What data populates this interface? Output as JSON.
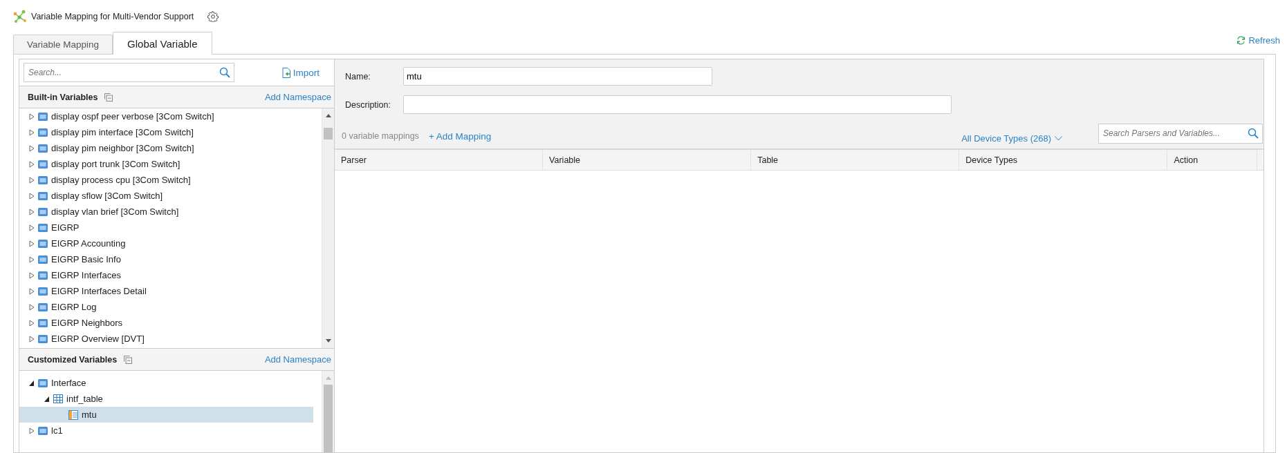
{
  "header": {
    "title": "Variable Mapping for Multi-Vendor Support"
  },
  "tabs": [
    {
      "label": "Variable Mapping",
      "selected": false
    },
    {
      "label": "Global Variable",
      "selected": true
    }
  ],
  "refresh": {
    "label": "Refresh"
  },
  "sidebar": {
    "search": {
      "placeholder": "Search..."
    },
    "import": {
      "label": "Import"
    },
    "builtin": {
      "title": "Built-in Variables",
      "action": "Add Namespace",
      "items": [
        {
          "label": "display ospf peer verbose [3Com Switch]",
          "kind": "namespace",
          "expanded": false,
          "selected": false
        },
        {
          "label": "display pim interface [3Com Switch]",
          "kind": "namespace",
          "expanded": false,
          "selected": false
        },
        {
          "label": "display pim neighbor [3Com Switch]",
          "kind": "namespace",
          "expanded": false,
          "selected": false
        },
        {
          "label": "display port trunk [3Com Switch]",
          "kind": "namespace",
          "expanded": false,
          "selected": false
        },
        {
          "label": "display process cpu [3Com Switch]",
          "kind": "namespace",
          "expanded": false,
          "selected": false
        },
        {
          "label": "display sflow [3Com Switch]",
          "kind": "namespace",
          "expanded": false,
          "selected": false
        },
        {
          "label": "display vlan brief [3Com Switch]",
          "kind": "namespace",
          "expanded": false,
          "selected": false
        },
        {
          "label": "EIGRP",
          "kind": "namespace",
          "expanded": false,
          "selected": false
        },
        {
          "label": "EIGRP Accounting",
          "kind": "namespace",
          "expanded": false,
          "selected": false
        },
        {
          "label": "EIGRP Basic Info",
          "kind": "namespace",
          "expanded": false,
          "selected": false
        },
        {
          "label": "EIGRP Interfaces",
          "kind": "namespace",
          "expanded": false,
          "selected": false
        },
        {
          "label": "EIGRP Interfaces Detail",
          "kind": "namespace",
          "expanded": false,
          "selected": false
        },
        {
          "label": "EIGRP Log",
          "kind": "namespace",
          "expanded": false,
          "selected": false
        },
        {
          "label": "EIGRP Neighbors",
          "kind": "namespace",
          "expanded": false,
          "selected": false
        },
        {
          "label": "EIGRP Overview [DVT]",
          "kind": "namespace",
          "expanded": false,
          "selected": false
        }
      ]
    },
    "customized": {
      "title": "Customized Variables",
      "action": "Add Namespace",
      "items": [
        {
          "label": "Interface",
          "kind": "namespace",
          "expanded": true,
          "selected": false,
          "children": [
            {
              "label": "intf_table",
              "kind": "table",
              "expanded": true,
              "selected": false,
              "children": [
                {
                  "label": "mtu",
                  "kind": "column",
                  "selected": true
                }
              ]
            }
          ]
        },
        {
          "label": "lc1",
          "kind": "namespace",
          "expanded": false,
          "selected": false
        }
      ]
    }
  },
  "form": {
    "name": {
      "label": "Name:",
      "value": "mtu"
    },
    "description": {
      "label": "Description:"
    }
  },
  "mappings": {
    "count": "0 variable mappings",
    "add": "+ Add Mapping",
    "filter": "All Device Types (268)",
    "search": {
      "placeholder": "Search Parsers and Variables..."
    }
  },
  "table": {
    "columns": [
      "Parser",
      "Variable",
      "Table",
      "Device Types",
      "Action"
    ]
  }
}
